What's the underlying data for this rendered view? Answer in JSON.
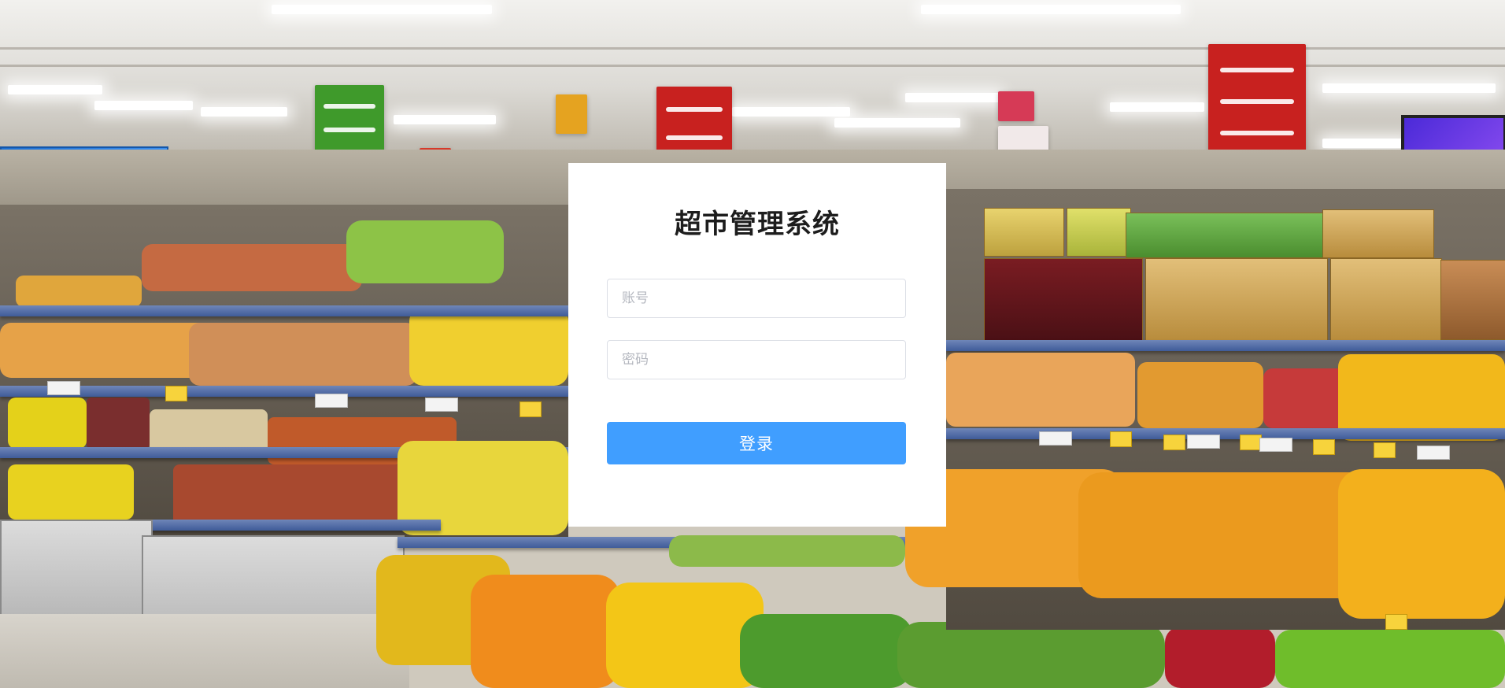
{
  "login": {
    "title": "超市管理系统",
    "account_placeholder": "账号",
    "account_value": "",
    "password_placeholder": "密码",
    "password_value": "",
    "submit_label": "登录"
  },
  "colors": {
    "primary_button": "#409eff",
    "card_background": "#ffffff",
    "input_border": "#dcdfe6"
  },
  "background": {
    "description_icon": "supermarket-produce-photo"
  }
}
